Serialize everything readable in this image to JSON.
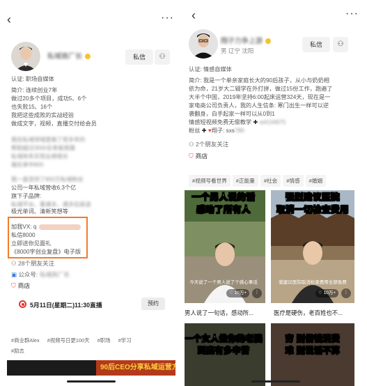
{
  "colors": {
    "accent_orange": "#f07c2a",
    "live_red": "#e9302d",
    "shop_red": "#e94e3d",
    "verified_gold": "#f4c430"
  },
  "left": {
    "nav": {
      "back_icon": "chevron-left-icon",
      "more_icon": "more-dots-icon",
      "back": "‹",
      "more": "···"
    },
    "profile": {
      "name": "私域商厂长",
      "message_label": "私信",
      "follow_icon": "add-friend-icon"
    },
    "bio_lines": [
      "认证: 职场自媒体",
      "简介: 连续创业7年",
      "做过20多个项目，成功5、6个",
      "也失败15、16个",
      "我把这些成败的实战经验",
      "做成文字，视频，直播交付给会员"
    ],
    "blurred_block_1": [
      "我在私域领域里做了很多年的",
      "帮助超过3000名老板搭建",
      "私域体系实现业绩增长",
      "福名单中800"
    ],
    "blurred_line_2": "我一直坚持了800万私域粉丝",
    "mid_lines": [
      "公司一年私域营收6.3个亿",
      "旗下子品牌:",
      "极光单词、清新笑想等"
    ],
    "blurred_mid_0": "私域平台，重课多，遇多拉英语",
    "boxed_lines": [
      "加我VX: q",
      "私信8000",
      "立即送你见面礼",
      "《8000字创业复盘》电子版"
    ],
    "mutual_friends": "28个朋友关注",
    "official_account": "公众号:",
    "official_account_blurred": "私域商厂长",
    "shop": "商店",
    "live": {
      "text": "5月11日(星期二)11:30直播",
      "button": "预约"
    },
    "tags": [
      "#商业群Alex",
      "#视频号日更100天",
      "#职场",
      "#学习",
      "#励志"
    ],
    "banner_text": "90后CEO分享私域运营方法"
  },
  "right": {
    "nav": {
      "back": "‹",
      "more": "···"
    },
    "profile": {
      "name": "翔子力争上游",
      "meta": "男 辽宁 沈阳",
      "message_label": "私信",
      "certification": "认证: 情感自媒体"
    },
    "bio_lines": [
      "简介: 我是一个单亲家庭长大的90后孩子，从小与奶奶相",
      "依为命，21岁大二辍学在外打拼，做过15份工作，跑遍了",
      "大半个中国，2019年坚持6:00起床运营324天，现在是一",
      "家电商公司负责人，我的人生信条: 寒门出生一样可以逆",
      "袭翻身，白手起家一样可以从0到1"
    ],
    "video_line": {
      "prefix": "情感短视频免费无偿教学",
      "suffix": "w4134675"
    },
    "fans_line": {
      "prefix": "粉丝",
      "middle": "翔子: sxs",
      "suffix": "786"
    },
    "mutual_friends": "2个朋友关注",
    "shop": "商店",
    "tags": [
      "#视频号看世界",
      "#正能量",
      "#社会",
      "#情感",
      "#婚姻"
    ],
    "cards": [
      {
        "headline_1": "一个男人说的话",
        "headline_2": "感动了所有人",
        "caption": "今天说了一个男人说了个感心事话",
        "likes": "10万+",
        "title": "男人说了一句话，感动所..."
      },
      {
        "headline_1": "强烈建议医院",
        "headline_2": "取消一切检查费用",
        "caption": "我建议医院取消检查费用全部免费",
        "likes": "10万+",
        "title": "医疗是硬伤，老百姓也不..."
      },
      {
        "headline_1": "一个女人做你的老婆",
        "headline_2": "到底有多辛苦",
        "caption": ""
      },
      {
        "headline_1": "穷 别借钱消费",
        "headline_2": "难 别说话不算",
        "caption": ""
      }
    ]
  }
}
